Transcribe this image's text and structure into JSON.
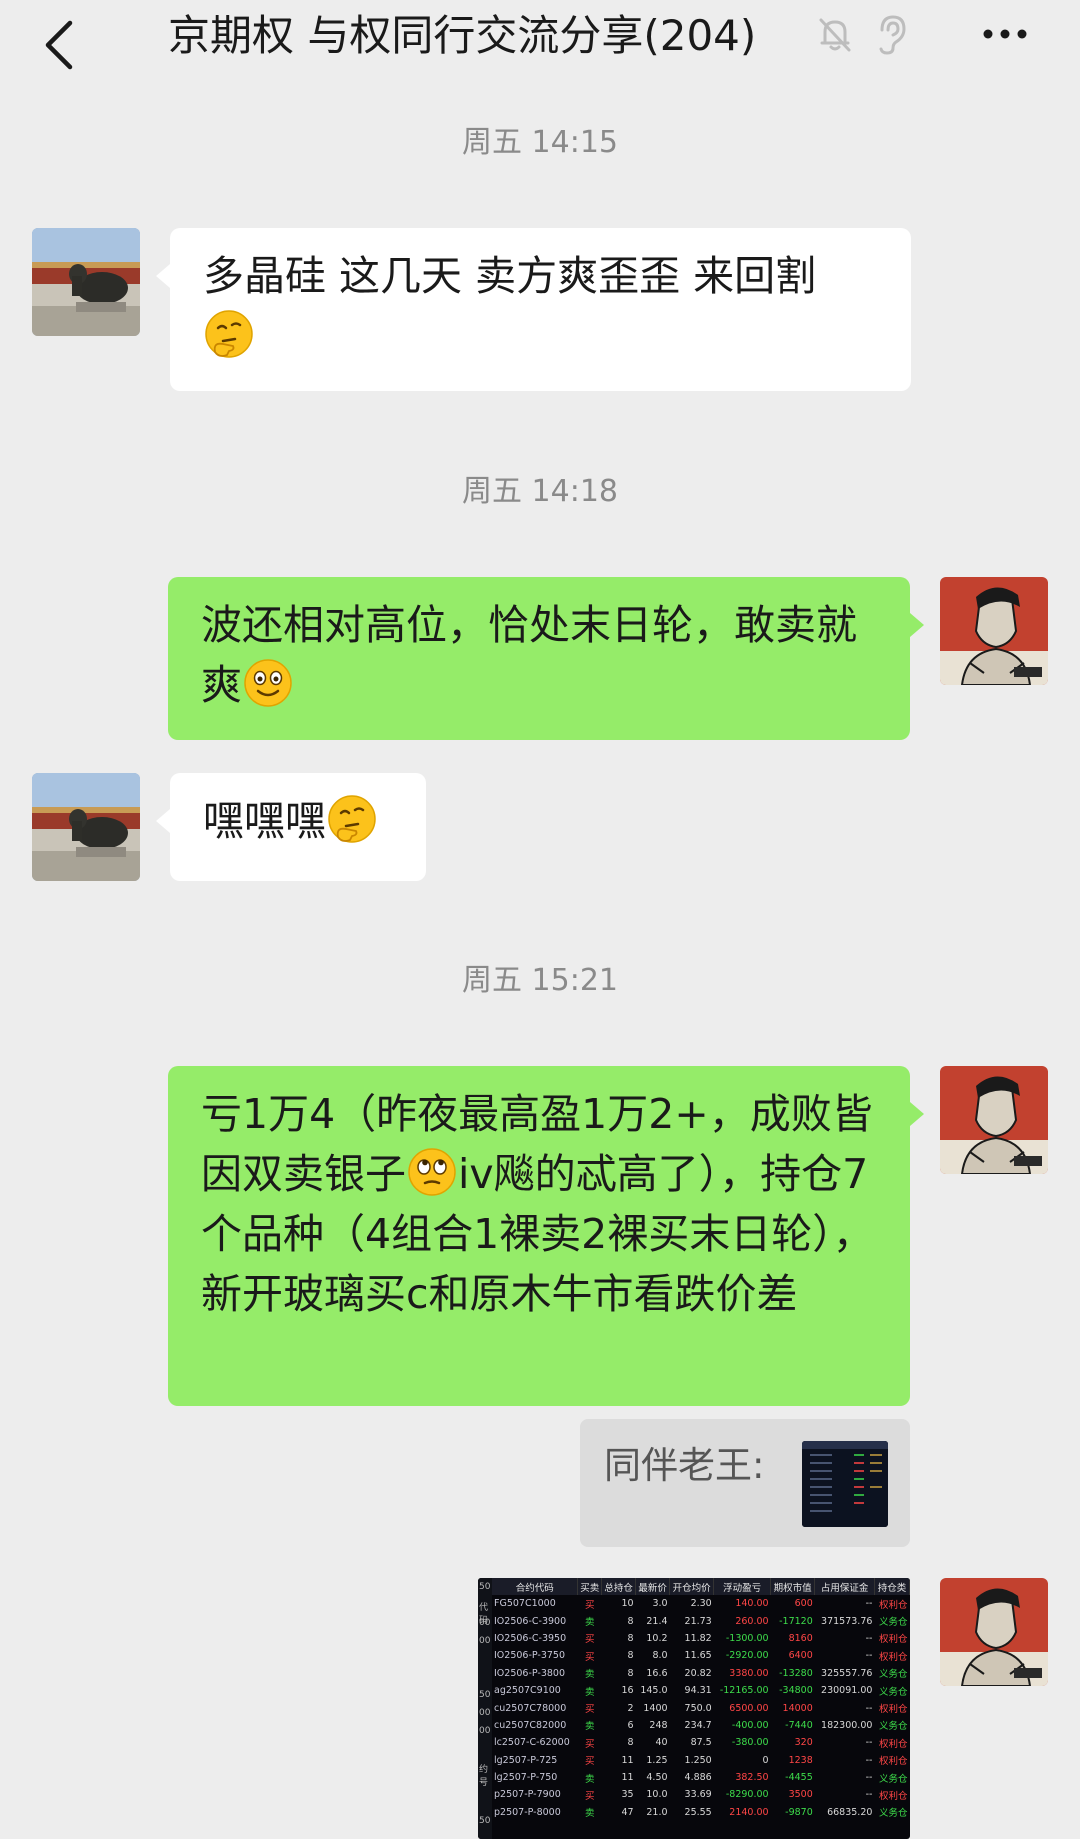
{
  "header": {
    "title": "京期权 与权同行交流分享(204)"
  },
  "colors": {
    "incoming_bubble": "#ffffff",
    "outgoing_bubble": "#95ec69",
    "background": "#ededed"
  },
  "messages": {
    "ts1": "周五 14:15",
    "m1": "多晶硅 这几天 卖方爽歪歪 来回割",
    "ts2": "周五 14:18",
    "m2": "波还相对高位，恰处末日轮，敢卖就爽",
    "m3": "嘿嘿嘿",
    "ts3": "周五 15:21",
    "m4_a": "亏1万4（昨夜最高盈1万2+，成败皆因双卖银子",
    "m4_b": "iv飚的忒高了），持仓7个品种（4组合1裸卖2裸买末日轮），新开玻璃买c和原木牛市看跌价差",
    "quote_label": "同伴老王:"
  },
  "icons": [
    "back-icon",
    "mute-bell-icon",
    "ear-icon",
    "more-icon",
    "thinking-emoji",
    "smile-emoji",
    "eye-roll-emoji"
  ],
  "table": {
    "headers": [
      "合约代码",
      "买卖",
      "总持仓",
      "最新价",
      "开仓均价",
      "浮动盈亏",
      "期权市值",
      "占用保证金",
      "持仓类"
    ],
    "rows": [
      [
        "FG507C1000",
        "买",
        "10",
        "3.0",
        "2.30",
        "140.00",
        "600",
        "--",
        "权利仓"
      ],
      [
        "IO2506-C-3900",
        "卖",
        "8",
        "21.4",
        "21.73",
        "260.00",
        "-17120",
        "371573.76",
        "义务仓"
      ],
      [
        "IO2506-C-3950",
        "买",
        "8",
        "10.2",
        "11.82",
        "-1300.00",
        "8160",
        "--",
        "权利仓"
      ],
      [
        "IO2506-P-3750",
        "买",
        "8",
        "8.0",
        "11.65",
        "-2920.00",
        "6400",
        "--",
        "权利仓"
      ],
      [
        "IO2506-P-3800",
        "卖",
        "8",
        "16.6",
        "20.82",
        "3380.00",
        "-13280",
        "325557.76",
        "义务仓"
      ],
      [
        "ag2507C9100",
        "卖",
        "16",
        "145.0",
        "94.31",
        "-12165.00",
        "-34800",
        "230091.00",
        "义务仓"
      ],
      [
        "cu2507C78000",
        "买",
        "2",
        "1400",
        "750.0",
        "6500.00",
        "14000",
        "--",
        "权利仓"
      ],
      [
        "cu2507C82000",
        "卖",
        "6",
        "248",
        "234.7",
        "-400.00",
        "-7440",
        "182300.00",
        "义务仓"
      ],
      [
        "lc2507-C-62000",
        "买",
        "8",
        "40",
        "87.5",
        "-380.00",
        "320",
        "--",
        "权利仓"
      ],
      [
        "lg2507-P-725",
        "买",
        "11",
        "1.25",
        "1.250",
        "0",
        "1238",
        "--",
        "权利仓"
      ],
      [
        "lg2507-P-750",
        "卖",
        "11",
        "4.50",
        "4.886",
        "382.50",
        "-4455",
        "--",
        "义务仓"
      ],
      [
        "p2507-P-7900",
        "买",
        "35",
        "10.0",
        "33.69",
        "-8290.00",
        "3500",
        "--",
        "权利仓"
      ],
      [
        "p2507-P-8000",
        "卖",
        "47",
        "21.0",
        "25.55",
        "2140.00",
        "-9870",
        "66835.20",
        "义务仓"
      ]
    ],
    "left_strip": [
      "50",
      "代码",
      "00",
      "00",
      "",
      "",
      "50",
      "00",
      "00",
      "",
      "约号",
      "",
      "",
      "50"
    ]
  }
}
